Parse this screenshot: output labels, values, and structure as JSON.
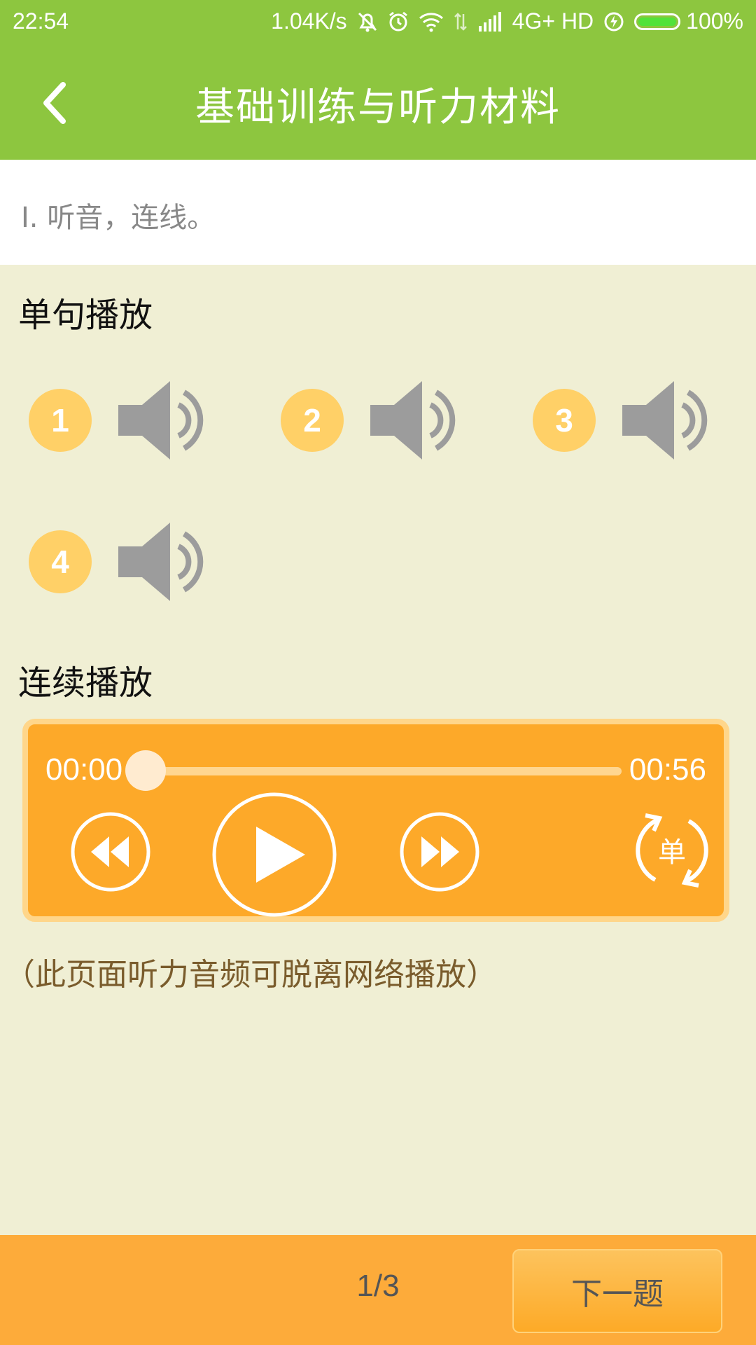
{
  "status_bar": {
    "time": "22:54",
    "network_speed": "1.04K/s",
    "network_type": "4G+ HD",
    "battery": "100%",
    "battery_level": 1.0,
    "icons": [
      "mute-bell-icon",
      "alarm-icon",
      "wifi-icon",
      "data-arrows-icon",
      "signal-icon",
      "charging-icon",
      "battery-icon"
    ]
  },
  "app_bar": {
    "title": "基础训练与听力材料",
    "back_icon": "chevron-left-icon"
  },
  "question": {
    "text": "I. 听音，连线。"
  },
  "single_play": {
    "title": "单句播放",
    "items": [
      {
        "number": "1",
        "icon": "speaker-icon"
      },
      {
        "number": "2",
        "icon": "speaker-icon"
      },
      {
        "number": "3",
        "icon": "speaker-icon"
      },
      {
        "number": "4",
        "icon": "speaker-icon"
      }
    ]
  },
  "continuous_play": {
    "title": "连续播放",
    "current_time": "00:00",
    "total_time": "00:56",
    "progress": 0.0,
    "controls": [
      "rewind-icon",
      "play-icon",
      "fast-forward-icon",
      "repeat-single-icon"
    ],
    "repeat_label": "单"
  },
  "offline_note": "（此页面听力音频可脱离网络播放）",
  "footer": {
    "page_indicator": "1/3",
    "next_label": "下一题"
  },
  "colors": {
    "header_green": "#8dc63f",
    "background": "#f0efd4",
    "badge_yellow": "#ffd067",
    "player_orange": "#fda929",
    "footer_orange": "#fdab3a"
  }
}
